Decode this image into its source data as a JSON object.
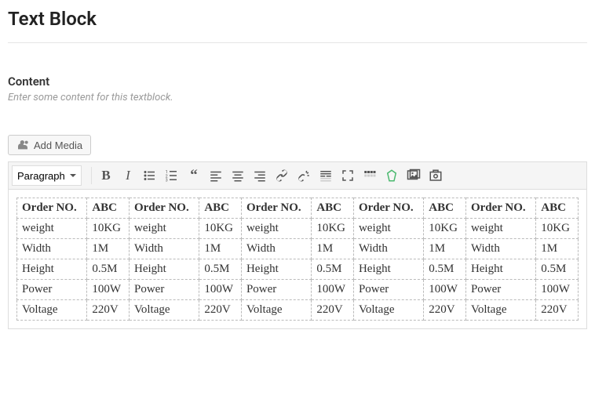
{
  "page_title": "Text Block",
  "content_section": {
    "label": "Content",
    "help": "Enter some content for this textblock."
  },
  "add_media_label": "Add Media",
  "format_select": {
    "value": "Paragraph"
  },
  "toolbar_icons": [
    "bold",
    "italic",
    "bullet-list",
    "numbered-list",
    "blockquote",
    "align-left",
    "align-center",
    "align-right",
    "link",
    "unlink",
    "insert-more",
    "fullscreen",
    "toolbar-toggle",
    "special",
    "insert-media",
    "insert-photo"
  ],
  "table": {
    "columns_pair": {
      "label_header": "Order NO.",
      "value_header": "ABC"
    },
    "repeat": 5,
    "rows": [
      {
        "label": "weight",
        "value": "10KG"
      },
      {
        "label": "Width",
        "value": "1M"
      },
      {
        "label": "Height",
        "value": "0.5M"
      },
      {
        "label": "Power",
        "value": "100W"
      },
      {
        "label": "Voltage",
        "value": "220V"
      }
    ]
  }
}
